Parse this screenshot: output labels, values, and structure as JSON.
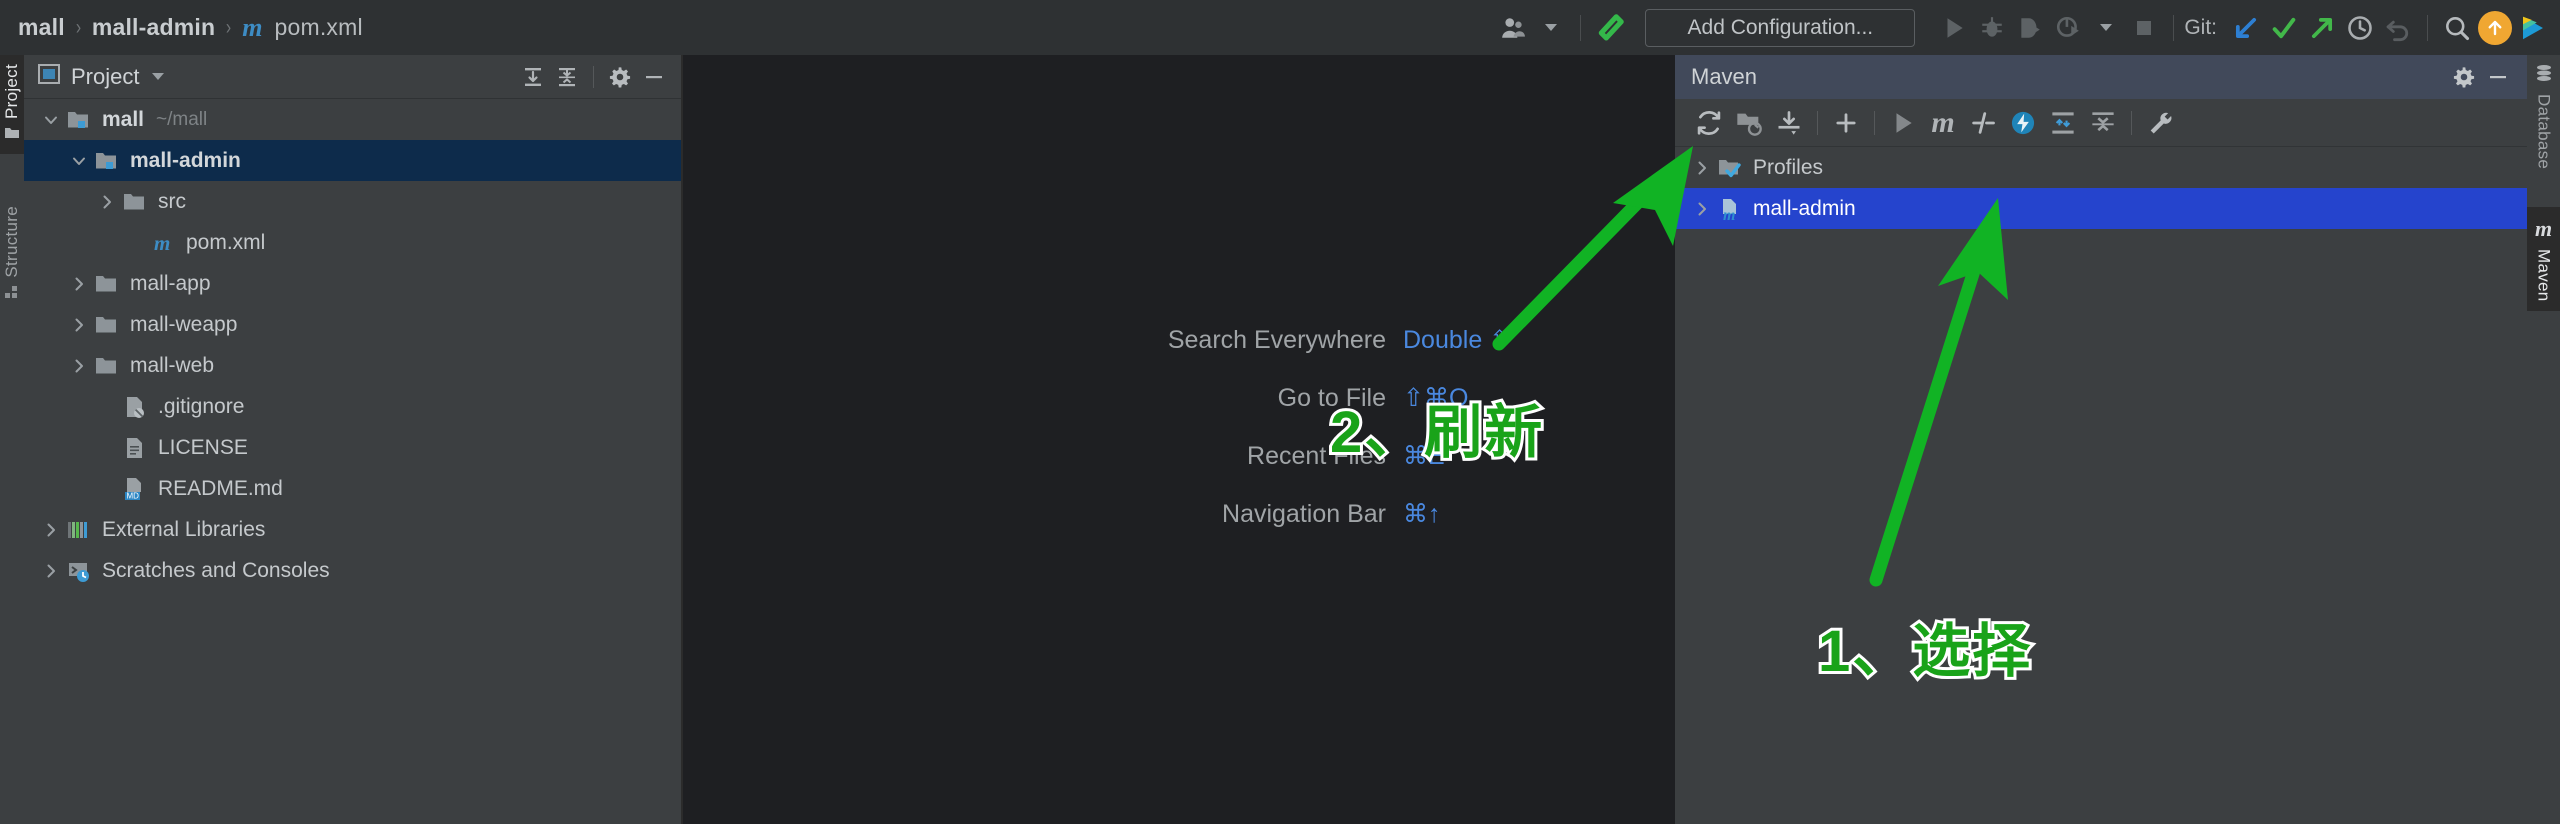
{
  "window": {
    "breadcrumb": [
      "mall",
      "mall-admin",
      "pom.xml"
    ],
    "breadcrumb_sep": "›"
  },
  "toolbar": {
    "avatar_icon": "user-avatar-icon",
    "build_icon": "build-hammer-icon",
    "run_config_label": "Add Configuration...",
    "run_icon": "run-icon",
    "debug_icon": "debug-bug-icon",
    "run_coverage_icon": "run-with-coverage-icon",
    "profiler_icon": "profiler-icon",
    "dropdown_icon": "chevron-down-icon",
    "stop_icon": "stop-icon",
    "git_label": "Git:",
    "git_update_icon": "git-update-project-icon",
    "git_commit_icon": "git-commit-icon",
    "git_push_icon": "git-push-icon",
    "git_history_icon": "git-history-clock-icon",
    "git_rollback_icon": "git-rollback-icon",
    "search_icon": "search-icon",
    "update_badge_icon": "update-available-icon",
    "ide_logo_icon": "ide-logo-icon"
  },
  "left_strip": {
    "tabs": [
      {
        "label": "Project",
        "icon": "folder-icon",
        "active": true
      },
      {
        "label": "Structure",
        "icon": "structure-icon",
        "active": false
      }
    ]
  },
  "right_strip": {
    "tabs": [
      {
        "label": "Database",
        "icon": "database-icon",
        "active": false
      },
      {
        "label": "Maven",
        "icon": "maven-m-icon",
        "active": true
      }
    ]
  },
  "project_panel": {
    "title": "Project",
    "dropdown_icon": "chevron-down-icon",
    "expand_all_icon": "expand-all-icon",
    "collapse_all_icon": "collapse-all-icon",
    "settings_icon": "gear-icon",
    "hide_icon": "hide-panel-icon",
    "tree": [
      {
        "label": "mall",
        "path": "~/mall",
        "icon": "module-folder-icon",
        "indent": 0,
        "arrow": "down",
        "bold": true,
        "selected": false
      },
      {
        "label": "mall-admin",
        "path": "",
        "icon": "module-folder-icon",
        "indent": 1,
        "arrow": "down",
        "bold": true,
        "selected": true
      },
      {
        "label": "src",
        "path": "",
        "icon": "folder-icon",
        "indent": 2,
        "arrow": "right",
        "bold": false,
        "selected": false
      },
      {
        "label": "pom.xml",
        "path": "",
        "icon": "maven-pom-icon",
        "indent": 3,
        "arrow": "none",
        "bold": false,
        "selected": false
      },
      {
        "label": "mall-app",
        "path": "",
        "icon": "folder-icon",
        "indent": 1,
        "arrow": "right",
        "bold": false,
        "selected": false
      },
      {
        "label": "mall-weapp",
        "path": "",
        "icon": "folder-icon",
        "indent": 1,
        "arrow": "right",
        "bold": false,
        "selected": false
      },
      {
        "label": "mall-web",
        "path": "",
        "icon": "folder-icon",
        "indent": 1,
        "arrow": "right",
        "bold": false,
        "selected": false
      },
      {
        "label": ".gitignore",
        "path": "",
        "icon": "gitignore-file-icon",
        "indent": 2,
        "arrow": "none",
        "bold": false,
        "selected": false
      },
      {
        "label": "LICENSE",
        "path": "",
        "icon": "text-file-icon",
        "indent": 2,
        "arrow": "none",
        "bold": false,
        "selected": false
      },
      {
        "label": "README.md",
        "path": "",
        "icon": "markdown-file-icon",
        "indent": 2,
        "arrow": "none",
        "bold": false,
        "selected": false
      },
      {
        "label": "External Libraries",
        "path": "",
        "icon": "libraries-icon",
        "indent": 0,
        "arrow": "right",
        "bold": false,
        "selected": false
      },
      {
        "label": "Scratches and Consoles",
        "path": "",
        "icon": "scratches-icon",
        "indent": 0,
        "arrow": "right",
        "bold": false,
        "selected": false
      }
    ]
  },
  "editor": {
    "hints": [
      {
        "label": "Search Everywhere",
        "key": "Double ⇧"
      },
      {
        "label": "Go to File",
        "key": "⇧⌘O"
      },
      {
        "label": "Recent Files",
        "key": "⌘E"
      },
      {
        "label": "Navigation Bar",
        "key": "⌘↑"
      }
    ]
  },
  "maven_panel": {
    "title": "Maven",
    "settings_icon": "gear-icon",
    "hide_icon": "hide-panel-icon",
    "toolbar_icons": [
      "reload-all-maven-projects-icon",
      "add-maven-project-icon",
      "download-sources-icon",
      "add-icon",
      "run-icon",
      "execute-maven-goal-icon",
      "toggle-skip-tests-icon",
      "toggle-offline-mode-icon",
      "expand-all-icon",
      "collapse-all-icon",
      "maven-settings-wrench-icon"
    ],
    "tree": [
      {
        "label": "Profiles",
        "icon": "maven-profiles-icon",
        "arrow": "right",
        "selected": false
      },
      {
        "label": "mall-admin",
        "icon": "maven-project-icon",
        "arrow": "right",
        "selected": true
      }
    ]
  },
  "annotations": [
    {
      "id": "step-1",
      "text": "1、选择",
      "color": "#19a319"
    },
    {
      "id": "step-2",
      "text": "2、刷新",
      "color": "#19a319"
    }
  ],
  "colors": {
    "accent_blue": "#2544cd",
    "tree_selection": "#0d2b4b",
    "annotation_green": "#19a319",
    "hint_key_blue": "#4a88df",
    "panel_bg": "#3c3f41",
    "editor_bg": "#1e1f22",
    "toolbar_bg": "#2e3133"
  }
}
